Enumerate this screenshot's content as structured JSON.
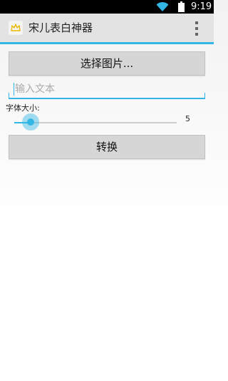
{
  "status_bar": {
    "time": "9:19",
    "icons": [
      "wifi-icon",
      "battery-icon"
    ]
  },
  "action_bar": {
    "title": "宋儿表白神器",
    "app_icon": "crown-icon",
    "overflow_icon": "overflow-menu-icon"
  },
  "form": {
    "pick_image_label": "选择图片...",
    "text_input": {
      "value": "",
      "placeholder": "输入文本"
    },
    "font_size_label": "字体大小:",
    "font_size_slider": {
      "value": "5",
      "fraction": 0.05
    },
    "convert_label": "转换"
  },
  "colors": {
    "accent": "#33b5e5",
    "action_bar_bg": "#e3e3e3",
    "button_bg": "#d6d6d6",
    "status_bar_bg": "#000000"
  }
}
